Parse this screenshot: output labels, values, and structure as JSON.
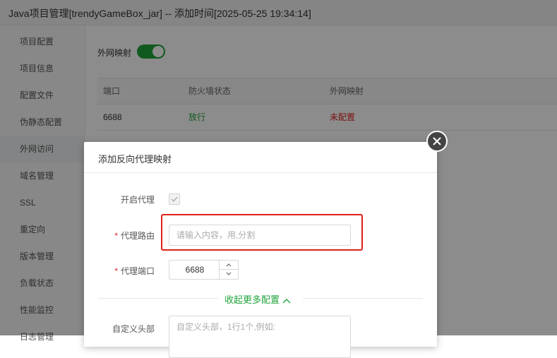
{
  "window": {
    "title": "Java项目管理[trendyGameBox_jar] -- 添加时间[2025-05-25 19:34:14]"
  },
  "sidebar": {
    "items": [
      {
        "label": "项目配置"
      },
      {
        "label": "项目信息"
      },
      {
        "label": "配置文件"
      },
      {
        "label": "伪静态配置"
      },
      {
        "label": "外网访问",
        "active": true
      },
      {
        "label": "域名管理"
      },
      {
        "label": "SSL"
      },
      {
        "label": "重定向"
      },
      {
        "label": "版本管理"
      },
      {
        "label": "负载状态"
      },
      {
        "label": "性能监控"
      },
      {
        "label": "日志管理"
      }
    ]
  },
  "content": {
    "switch_label": "外网映射",
    "switch_on": true,
    "table": {
      "headers": [
        "端口",
        "防火墙状态",
        "外网映射"
      ],
      "rows": [
        {
          "port": "6688",
          "firewall": "放行",
          "mapping": "未配置"
        }
      ]
    }
  },
  "modal": {
    "title": "添加反向代理映射",
    "enable_proxy_label": "开启代理",
    "enable_proxy_checked": true,
    "proxy_route_label": "代理路由",
    "proxy_route_placeholder": "请输入内容，用,分割",
    "proxy_route_value": "",
    "proxy_port_label": "代理端口",
    "proxy_port_value": "6688",
    "collapse_label": "收起更多配置",
    "custom_header_label": "自定义头部",
    "custom_header_placeholder": "自定义头部，1行1个,例如:",
    "required_mark": "*"
  },
  "colors": {
    "accent": "#20a53a",
    "danger": "#e02020",
    "highlight": "#e0201a"
  },
  "icons": {
    "close": "close-icon",
    "check": "check-icon",
    "chevron_up": "chevron-up-icon",
    "chevron_down": "chevron-down-icon"
  }
}
